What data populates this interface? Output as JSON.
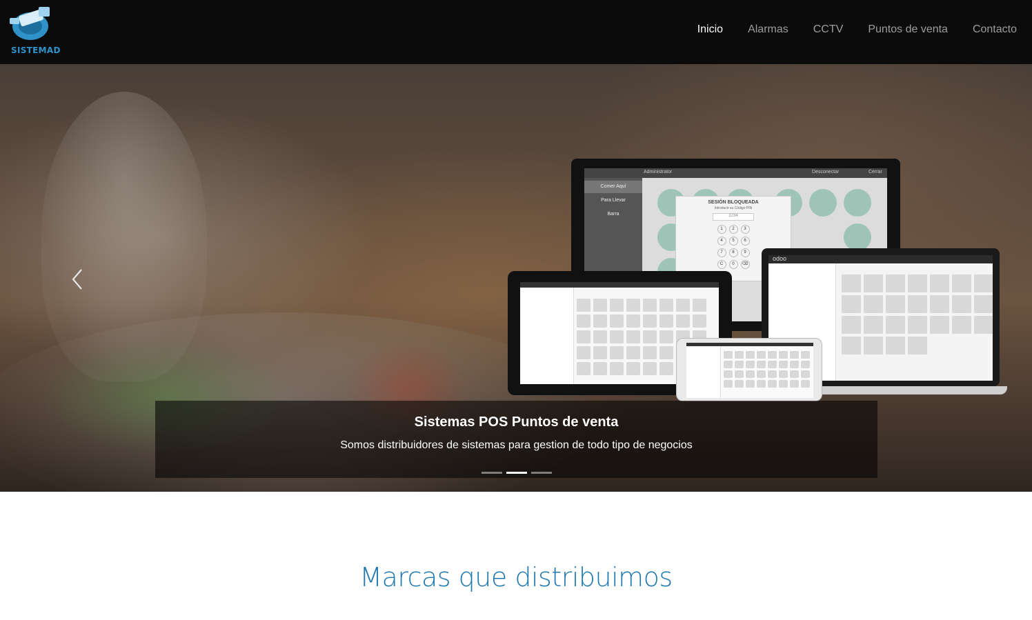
{
  "brand": {
    "logo_text": "SISTEMAD",
    "accent": "#2f93c9"
  },
  "nav": {
    "items": [
      {
        "label": "Inicio",
        "active": true
      },
      {
        "label": "Alarmas",
        "active": false
      },
      {
        "label": "CCTV",
        "active": false
      },
      {
        "label": "Puntos de venta",
        "active": false
      },
      {
        "label": "Contacto",
        "active": false
      }
    ]
  },
  "carousel": {
    "caption_title": "Sistemas POS Puntos de venta",
    "caption_text": "Somos distribuidores de sistemas para gestion de todo tipo de negocios",
    "slide_count": 3,
    "active_slide": 2,
    "prev_icon": "chevron-left-icon"
  },
  "pos_screen": {
    "header_user": "Administrator",
    "header_disconnect": "Desconectar",
    "header_close": "Cerrar",
    "menu": [
      "Comer Aquí",
      "Para Llevar",
      "Barra"
    ],
    "lock_title": "SESIÓN BLOQUEADA",
    "lock_subtitle": "Introducir su Código PIN",
    "lock_pin": "1234",
    "keypad": [
      "1",
      "2",
      "3",
      "4",
      "5",
      "6",
      "7",
      "8",
      "9",
      "C",
      "0",
      "⌫"
    ],
    "laptop_logo": "odoo"
  },
  "brands": {
    "title": "Marcas que distribuimos"
  }
}
